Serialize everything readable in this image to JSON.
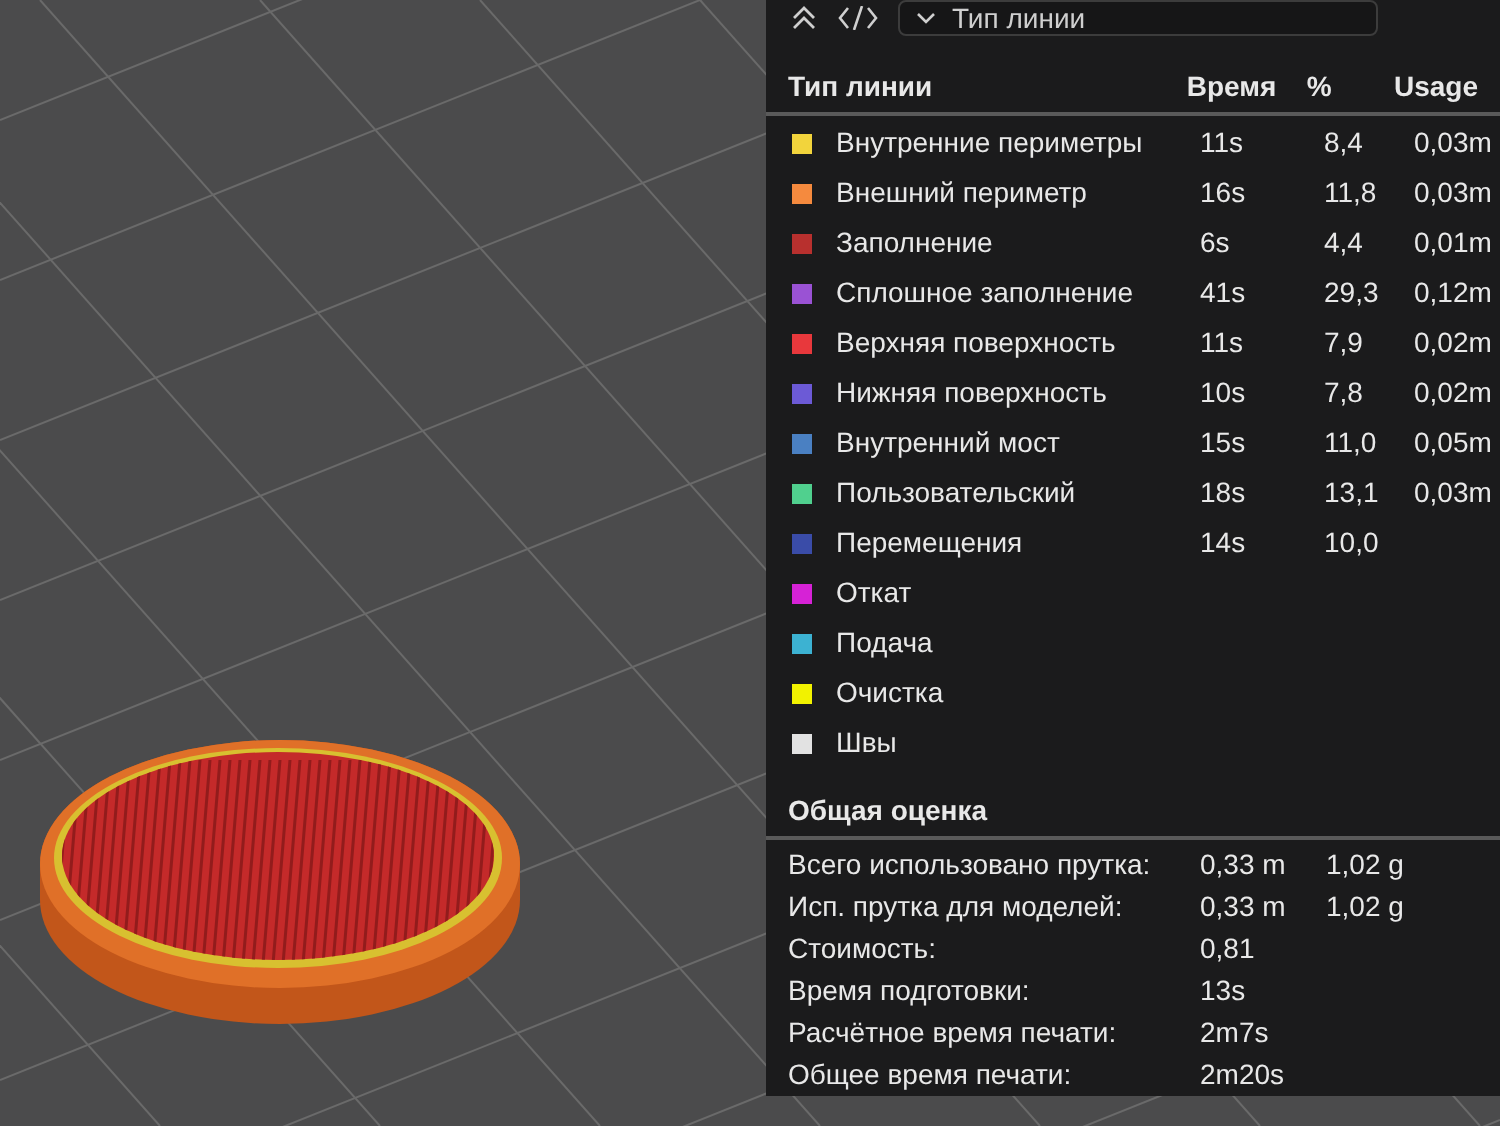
{
  "toolbar": {
    "dropdown": {
      "value": "Тип линии"
    }
  },
  "table": {
    "columns": [
      "Тип линии",
      "Время",
      "%",
      "Usage"
    ],
    "rows": [
      {
        "color": "#f2d43c",
        "name": "Внутренние периметры",
        "time": "11s",
        "percent": "8,4",
        "usage": "0,03m"
      },
      {
        "color": "#f58a3e",
        "name": "Внешний периметр",
        "time": "16s",
        "percent": "11,8",
        "usage": "0,03m"
      },
      {
        "color": "#b8302e",
        "name": "Заполнение",
        "time": "6s",
        "percent": "4,4",
        "usage": "0,01m"
      },
      {
        "color": "#9a52d4",
        "name": "Сплошное заполнение",
        "time": "41s",
        "percent": "29,3",
        "usage": "0,12m"
      },
      {
        "color": "#e8383c",
        "name": "Верхняя поверхность",
        "time": "11s",
        "percent": "7,9",
        "usage": "0,02m"
      },
      {
        "color": "#6c5ad6",
        "name": "Нижняя поверхность",
        "time": "10s",
        "percent": "7,8",
        "usage": "0,02m"
      },
      {
        "color": "#4a80c2",
        "name": "Внутренний мост",
        "time": "15s",
        "percent": "11,0",
        "usage": "0,05m"
      },
      {
        "color": "#50d08e",
        "name": "Пользовательский",
        "time": "18s",
        "percent": "13,1",
        "usage": "0,03m"
      },
      {
        "color": "#3a4ca8",
        "name": "Перемещения",
        "time": "14s",
        "percent": "10,0"
      },
      {
        "color": "#d622d6",
        "name": "Откат"
      },
      {
        "color": "#3cb2d2",
        "name": "Подача"
      },
      {
        "color": "#f2f200",
        "name": "Очистка"
      },
      {
        "color": "#e2e2e2",
        "name": "Швы"
      }
    ]
  },
  "summary": {
    "title": "Общая оценка",
    "rows": [
      {
        "label": "Всего использовано прутка:",
        "values": [
          "0,33 m",
          "1,02 g"
        ]
      },
      {
        "label": "Исп. прутка для моделей:",
        "values": [
          "0,33 m",
          "1,02 g"
        ]
      },
      {
        "label": "Стоимость:",
        "values": [
          "0,81"
        ]
      },
      {
        "label": "Время подготовки:",
        "values": [
          "13s"
        ]
      },
      {
        "label": "Расчётное время печати:",
        "values": [
          "2m7s"
        ]
      },
      {
        "label": "Общее время печати:",
        "values": [
          "2m20s"
        ]
      }
    ]
  }
}
